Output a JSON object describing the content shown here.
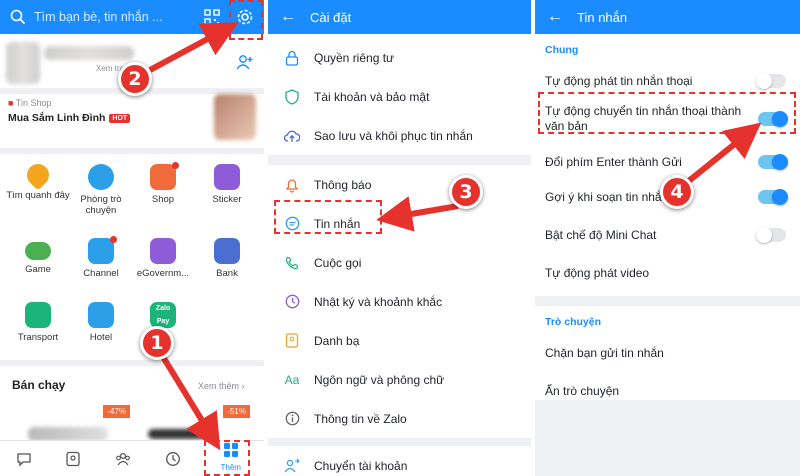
{
  "colors": {
    "brand": "#1a8cff",
    "annotation": "#e5322d",
    "toggle_on": "#1a8cff",
    "bg_gray": "#eef0f3"
  },
  "panel_home": {
    "search_placeholder": "Tìm bạn bè, tin nhắn ...",
    "profile_hint": "Xem trang",
    "tinshop_label": "Tin Shop",
    "tinshop_title": "Mua Sắm Linh Đình",
    "hot_badge": "HOT",
    "apps": [
      {
        "label": "Tìm quanh đây",
        "icon": "location-icon",
        "color": "#f2a51d"
      },
      {
        "label": "Phòng trò chuyện",
        "icon": "chat-room-icon",
        "color": "#2ba0e8"
      },
      {
        "label": "Shop",
        "icon": "shop-icon",
        "color": "#f06a3a"
      },
      {
        "label": "Sticker",
        "icon": "sticker-icon",
        "color": "#8e5cd9"
      },
      {
        "label": "Game",
        "icon": "game-icon",
        "color": "#4caf50"
      },
      {
        "label": "Channel",
        "icon": "channel-icon",
        "color": "#2ba0e8"
      },
      {
        "label": "eGovernm...",
        "icon": "government-icon",
        "color": "#8e5cd9"
      },
      {
        "label": "Bank",
        "icon": "bank-icon",
        "color": "#4a6fd1"
      },
      {
        "label": "Transport",
        "icon": "bus-icon",
        "color": "#1bb57a"
      },
      {
        "label": "Hotel",
        "icon": "hotel-icon",
        "color": "#2ba0e8"
      },
      {
        "label": "Zalo Pay",
        "icon": "zalopay-icon",
        "color": "#1bb57a"
      }
    ],
    "best_sellers_title": "Bán chạy",
    "see_more": "Xem thêm",
    "discounts": [
      "-47%",
      "-51%"
    ],
    "nav_more_label": "Thêm"
  },
  "panel_settings": {
    "title": "Cài đặt",
    "items": [
      {
        "label": "Quyền riêng tư",
        "icon": "lock-icon"
      },
      {
        "label": "Tài khoản và bảo mật",
        "icon": "shield-icon"
      },
      {
        "label": "Sao lưu và khôi phục tin nhắn",
        "icon": "cloud-backup-icon"
      },
      {
        "label": "Thông báo",
        "icon": "bell-icon"
      },
      {
        "label": "Tin nhắn",
        "icon": "message-icon"
      },
      {
        "label": "Cuộc gọi",
        "icon": "phone-icon"
      },
      {
        "label": "Nhật ký và khoảnh khắc",
        "icon": "clock-icon"
      },
      {
        "label": "Danh bạ",
        "icon": "contacts-icon"
      },
      {
        "label": "Ngôn ngữ và phông chữ",
        "icon": "language-icon"
      },
      {
        "label": "Thông tin về Zalo",
        "icon": "info-icon"
      },
      {
        "label": "Chuyển tài khoản",
        "icon": "switch-account-icon"
      }
    ]
  },
  "panel_messages": {
    "title": "Tin nhắn",
    "section_general": "Chung",
    "rows": [
      {
        "label": "Tự động phát tin nhắn thoại",
        "toggle": "off"
      },
      {
        "label": "Tự động chuyển tin nhắn thoại thành văn bản",
        "toggle": "on"
      },
      {
        "label": "Đổi phím Enter thành Gửi",
        "toggle": "on"
      },
      {
        "label": "Gợi ý khi soạn tin nhắn",
        "toggle": "on"
      },
      {
        "label": "Bật chế độ Mini Chat",
        "toggle": "off"
      },
      {
        "label": "Tự động phát video",
        "toggle": "none"
      }
    ],
    "section_chat": "Trò chuyện",
    "chat_rows": [
      "Chặn bạn gửi tin nhắn",
      "Ẩn trò chuyện"
    ]
  },
  "steps": [
    "1",
    "2",
    "3",
    "4"
  ]
}
